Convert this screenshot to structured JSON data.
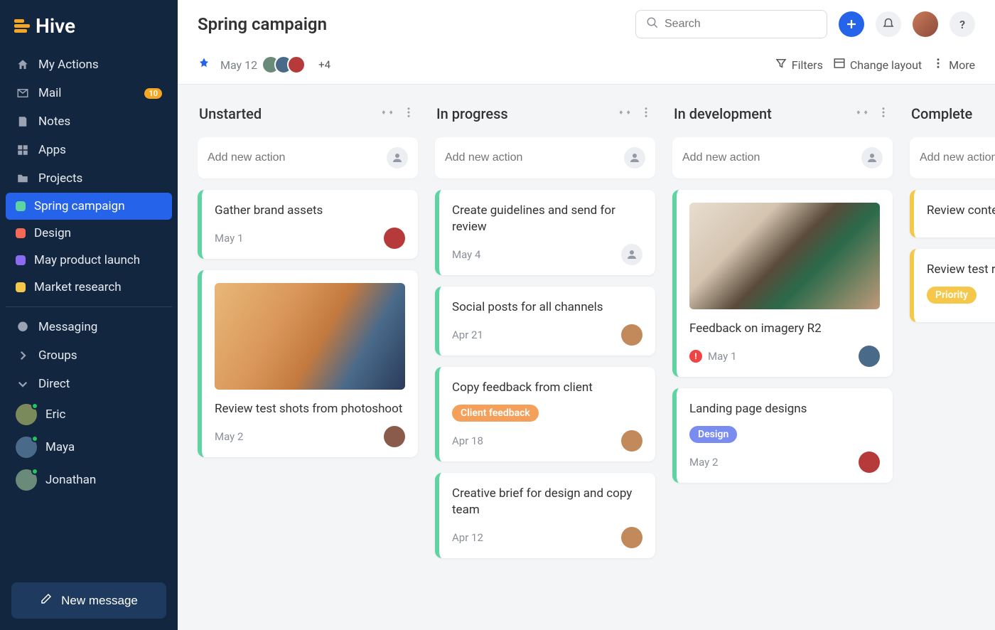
{
  "app": {
    "name": "Hive"
  },
  "page": {
    "title": "Spring campaign",
    "date": "May 12",
    "avatar_overflow": "+4"
  },
  "search": {
    "placeholder": "Search"
  },
  "actions": {
    "filters": "Filters",
    "change_layout": "Change layout",
    "more": "More"
  },
  "sidebar": {
    "items": [
      {
        "icon": "home-icon",
        "label": "My Actions"
      },
      {
        "icon": "mail-icon",
        "label": "Mail",
        "badge": "10"
      },
      {
        "icon": "note-icon",
        "label": "Notes"
      },
      {
        "icon": "apps-icon",
        "label": "Apps"
      },
      {
        "icon": "folder-icon",
        "label": "Projects"
      }
    ],
    "projects": [
      {
        "color": "#5fd3a2",
        "label": "Spring campaign",
        "active": true
      },
      {
        "color": "#f46a55",
        "label": "Design"
      },
      {
        "color": "#8b6cf0",
        "label": "May product launch"
      },
      {
        "color": "#f5c84b",
        "label": "Market research"
      }
    ],
    "messaging": "Messaging",
    "groups": "Groups",
    "direct": "Direct",
    "dms": [
      {
        "label": "Eric",
        "color": "#7a8a5a"
      },
      {
        "label": "Maya",
        "color": "#4a6a8a"
      },
      {
        "label": "Jonathan",
        "color": "#6a8a7a"
      }
    ],
    "new_message": "New message"
  },
  "board": {
    "add_placeholder": "Add new action",
    "columns": [
      {
        "title": "Unstarted",
        "cards": [
          {
            "title": "Gather brand assets",
            "date": "May 1",
            "accent": "#5fd3a2",
            "assignee_color": "#b73a3a"
          },
          {
            "title": "Review test shots from photoshoot",
            "date": "May 2",
            "accent": "#5fd3a2",
            "image": true,
            "image_style": "linear-gradient(120deg,#e8b878 0%,#d9965a 35%,#c47a3e 55%,#4a6a8a 75%,#2a3a5a 100%)",
            "assignee_color": "#8a5a4a"
          }
        ]
      },
      {
        "title": "In progress",
        "cards": [
          {
            "title": "Create guidelines and send for review",
            "date": "May 4",
            "accent": "#5fd3a2",
            "unassigned": true
          },
          {
            "title": "Social posts for all channels",
            "date": "Apr 21",
            "accent": "#5fd3a2",
            "assignee_color": "#c28a5a"
          },
          {
            "title": "Copy feedback from client",
            "date": "Apr 18",
            "accent": "#5fd3a2",
            "tag": {
              "label": "Client feedback",
              "color": "#f5a05a"
            },
            "assignee_color": "#c28a5a"
          },
          {
            "title": "Creative brief for design and copy team",
            "date": "Apr 12",
            "accent": "#5fd3a2",
            "assignee_color": "#c28a5a"
          }
        ]
      },
      {
        "title": "In development",
        "cards": [
          {
            "title": "Feedback on imagery R2",
            "date": "May 1",
            "accent": "#5fd3a2",
            "image": true,
            "image_style": "linear-gradient(135deg,#e8ded0 0%,#d4c4b0 30%,#5a4a3a 50%,#2a6a4a 65%,#c09a7a 100%)",
            "alert": true,
            "assignee_color": "#4a6a8a"
          },
          {
            "title": "Landing page designs",
            "date": "May 2",
            "accent": "#5fd3a2",
            "tag": {
              "label": "Design",
              "color": "#7a8cf0"
            },
            "assignee_color": "#b73a3a"
          }
        ]
      },
      {
        "title": "Complete",
        "cards": [
          {
            "title": "Review content strategy",
            "date": "",
            "accent": "#f5c84b",
            "partial": true
          },
          {
            "title": "Review test results",
            "date": "",
            "accent": "#f5c84b",
            "partial": true,
            "tag": {
              "label": "Priority",
              "color": "#f5c84b"
            }
          }
        ]
      }
    ]
  }
}
